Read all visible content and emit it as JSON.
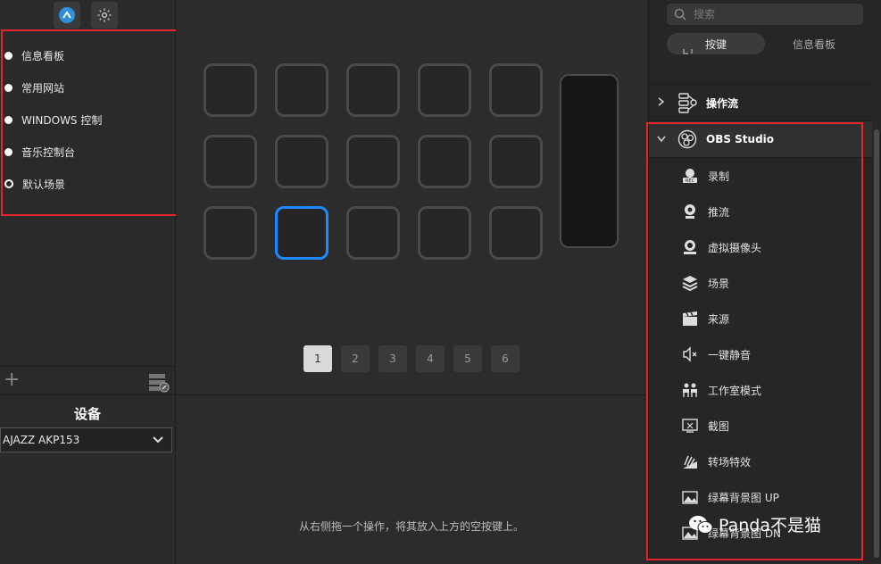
{
  "left_panel": {
    "scenes": [
      {
        "label": "信息看板",
        "active": true
      },
      {
        "label": "常用网站",
        "active": true
      },
      {
        "label": "WINDOWS 控制",
        "active": true
      },
      {
        "label": "音乐控制台",
        "active": true
      },
      {
        "label": "默认场景",
        "active": false
      }
    ],
    "device_title": "设备",
    "device_value": "AJAZZ AKP153"
  },
  "center": {
    "pages": [
      "1",
      "2",
      "3",
      "4",
      "5",
      "6"
    ],
    "active_page": "1",
    "hint": "从右侧拖一个操作，将其放入上方的空按键上。"
  },
  "right_panel": {
    "search_placeholder": "搜索",
    "tabs": [
      "按键",
      "信息看板"
    ],
    "categories": {
      "workflow": "操作流",
      "obs": "OBS Studio"
    },
    "obs_actions": [
      {
        "label": "录制",
        "icon": "rec-icon"
      },
      {
        "label": "推流",
        "icon": "stream-icon"
      },
      {
        "label": "虚拟摄像头",
        "icon": "webcam-icon"
      },
      {
        "label": "场景",
        "icon": "layers-icon"
      },
      {
        "label": "来源",
        "icon": "clapper-icon"
      },
      {
        "label": "一键静音",
        "icon": "mute-icon"
      },
      {
        "label": "工作室模式",
        "icon": "studio-icon"
      },
      {
        "label": "截图",
        "icon": "screenshot-icon"
      },
      {
        "label": "转场特效",
        "icon": "transition-icon"
      },
      {
        "label": "绿幕背景图 UP",
        "icon": "greenscreen-icon"
      },
      {
        "label": "绿幕背景图 DN",
        "icon": "greenscreen-icon"
      }
    ],
    "watermark": "Panda不是猫"
  },
  "colors": {
    "highlight": "#e2262b",
    "selected_key": "#1e88ff",
    "accent": "#2f8fd8"
  }
}
